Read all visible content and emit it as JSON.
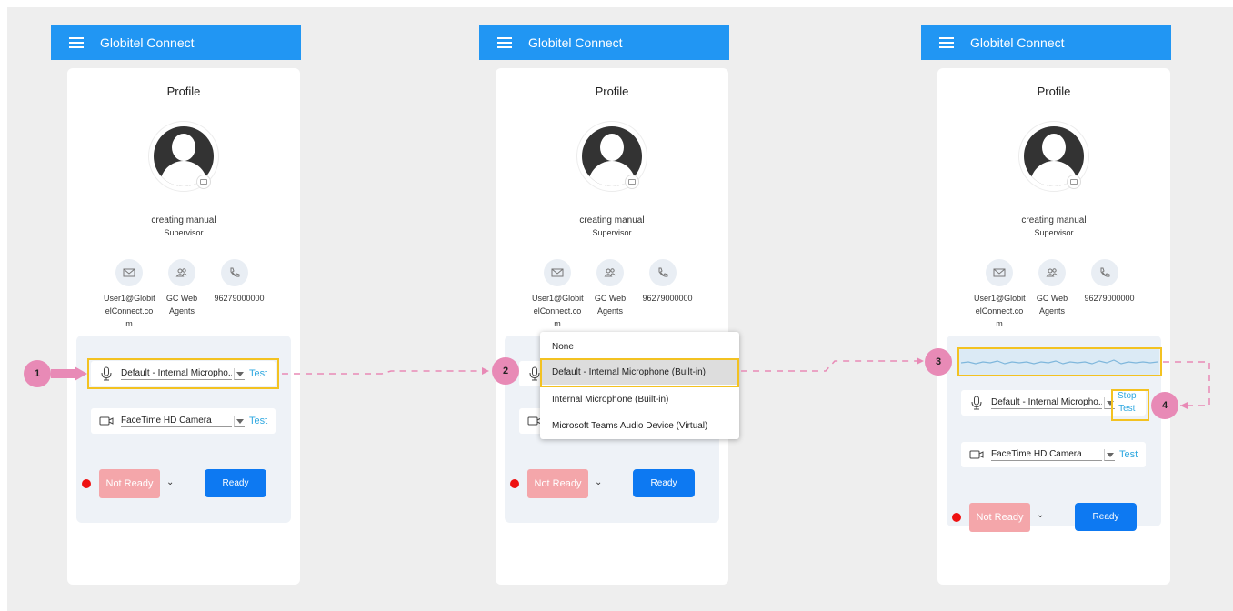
{
  "app": {
    "title": "Globitel Connect"
  },
  "profile": {
    "heading": "Profile",
    "name": "creating manual",
    "role": "Supervisor",
    "email_lines": [
      "User1@Globit",
      "elConnect.co",
      "m"
    ],
    "group_lines": [
      "GC Web",
      "Agents"
    ],
    "phone": "96279000000"
  },
  "devices": {
    "microphone": "Default - Internal Micropho...",
    "camera": "FaceTime HD Camera",
    "test_label": "Test",
    "stop_label": "Stop"
  },
  "status": {
    "not_ready_label": "Not Ready",
    "ready_label": "Ready"
  },
  "dropdown": {
    "options": [
      "None",
      "Default - Internal Microphone (Built-in)",
      "Internal Microphone (Built-in)",
      "Microsoft Teams Audio Device (Virtual)"
    ],
    "selected_index": 1
  },
  "steps": [
    "1",
    "2",
    "3",
    "4"
  ],
  "colors": {
    "appbar": "#2196f3",
    "highlight": "#f3c221",
    "badge": "#e88ab6",
    "ready": "#0d79f2",
    "not_ready": "#f4a6aa",
    "test_link": "#2fa8e0"
  }
}
